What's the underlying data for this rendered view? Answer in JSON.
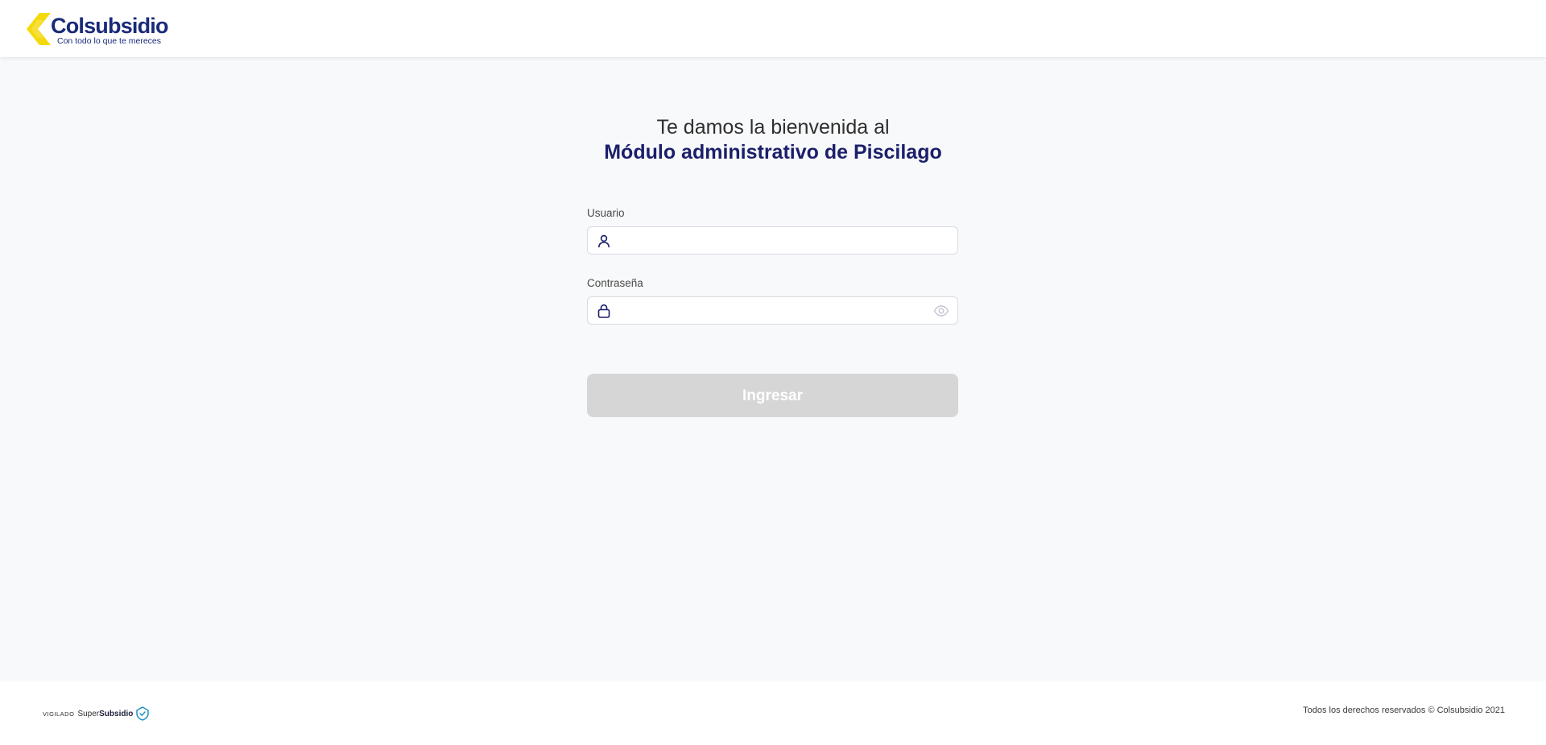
{
  "header": {
    "logo": {
      "name": "Colsubsidio",
      "tagline": "Con todo lo que te mereces"
    }
  },
  "main": {
    "welcome": "Te damos la bienvenida al",
    "module_title": "Módulo administrativo de Piscilago",
    "form": {
      "user": {
        "label": "Usuario",
        "value": "",
        "placeholder": "",
        "icon": "user-icon"
      },
      "password": {
        "label": "Contraseña",
        "value": "",
        "placeholder": "",
        "icon": "lock-icon",
        "toggle_icon": "eye-icon"
      },
      "submit_label": "Ingresar",
      "submit_state": "disabled"
    }
  },
  "footer": {
    "vigilado": {
      "prefix": "VIGILADO",
      "brand_light": "Super",
      "brand_bold": "Subsidio"
    },
    "copyright": "Todos los derechos reservados © Colsubsidio 2021"
  },
  "colors": {
    "brand_navy": "#1b1f6b",
    "brand_yellow": "#f5d90a",
    "disabled_button": "#d6d6d6",
    "background": "#f8f9fb"
  }
}
